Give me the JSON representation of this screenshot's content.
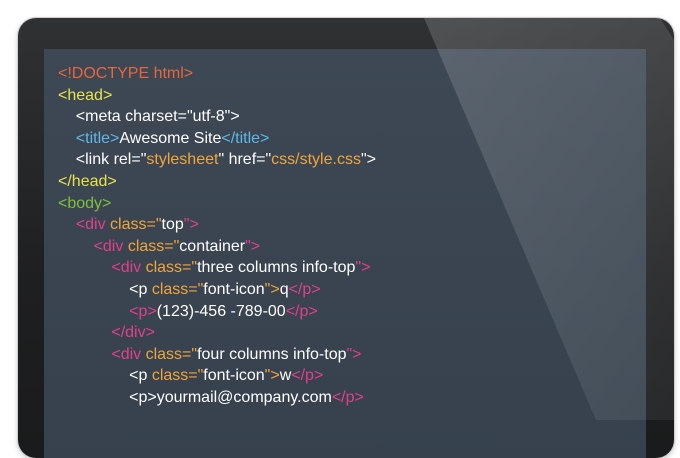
{
  "colors": {
    "doctype": "#e8663e",
    "head_tag": "#e7e34b",
    "text": "#ffffff",
    "title_tag": "#5cb8e6",
    "attr_value": "#f0a53a",
    "body_tag": "#7fbf3f",
    "div_tag": "#e0408a",
    "screen_bg": "#3a4551"
  },
  "code_lines": [
    [
      {
        "text": "<!DOCTYPE html>",
        "c": "doctype"
      }
    ],
    [
      {
        "text": "<head>",
        "c": "yellow"
      }
    ],
    [
      {
        "text": "    <meta charset=\"utf-8\">",
        "c": "white"
      }
    ],
    [
      {
        "text": "    ",
        "c": "white"
      },
      {
        "text": "<title>",
        "c": "blue"
      },
      {
        "text": "Awesome Site",
        "c": "white"
      },
      {
        "text": "</title>",
        "c": "blue"
      }
    ],
    [
      {
        "text": "    <link rel=\"",
        "c": "white"
      },
      {
        "text": "stylesheet",
        "c": "orange"
      },
      {
        "text": "\" href=\"",
        "c": "white"
      },
      {
        "text": "css/style.css",
        "c": "orange"
      },
      {
        "text": "\">",
        "c": "white"
      }
    ],
    [
      {
        "text": "</head>",
        "c": "yellow"
      }
    ],
    [
      {
        "text": "<body>",
        "c": "green"
      }
    ],
    [
      {
        "text": "    <div ",
        "c": "pink"
      },
      {
        "text": "class=\"",
        "c": "orange"
      },
      {
        "text": "top",
        "c": "white"
      },
      {
        "text": "\">",
        "c": "pink"
      }
    ],
    [
      {
        "text": "        <div ",
        "c": "pink"
      },
      {
        "text": "class=\"",
        "c": "orange"
      },
      {
        "text": "container",
        "c": "white"
      },
      {
        "text": "\">",
        "c": "pink"
      }
    ],
    [
      {
        "text": "            <div ",
        "c": "pink"
      },
      {
        "text": "class=\"",
        "c": "orange"
      },
      {
        "text": "three columns info-top",
        "c": "white"
      },
      {
        "text": "\">",
        "c": "pink"
      }
    ],
    [
      {
        "text": "                <p ",
        "c": "white"
      },
      {
        "text": "class=\"",
        "c": "orange"
      },
      {
        "text": "font-icon",
        "c": "white"
      },
      {
        "text": "\">",
        "c": "orange"
      },
      {
        "text": "q",
        "c": "white"
      },
      {
        "text": "</p>",
        "c": "pink"
      }
    ],
    [
      {
        "text": "                ",
        "c": "white"
      },
      {
        "text": "<p>",
        "c": "pink"
      },
      {
        "text": "(123)-456 -789-00",
        "c": "white"
      },
      {
        "text": "</p>",
        "c": "pink"
      }
    ],
    [
      {
        "text": "            </div>",
        "c": "pink"
      }
    ],
    [
      {
        "text": "            <div ",
        "c": "pink"
      },
      {
        "text": "class=\"",
        "c": "orange"
      },
      {
        "text": "four columns info-top",
        "c": "white"
      },
      {
        "text": "\">",
        "c": "pink"
      }
    ],
    [
      {
        "text": "                <p ",
        "c": "white"
      },
      {
        "text": "class=\"",
        "c": "orange"
      },
      {
        "text": "font-icon",
        "c": "white"
      },
      {
        "text": "\">",
        "c": "orange"
      },
      {
        "text": "w",
        "c": "white"
      },
      {
        "text": "</p>",
        "c": "pink"
      }
    ],
    [
      {
        "text": "                <p>",
        "c": "white"
      },
      {
        "text": "yourmail@company.com",
        "c": "white"
      },
      {
        "text": "</p>",
        "c": "pink"
      }
    ]
  ]
}
